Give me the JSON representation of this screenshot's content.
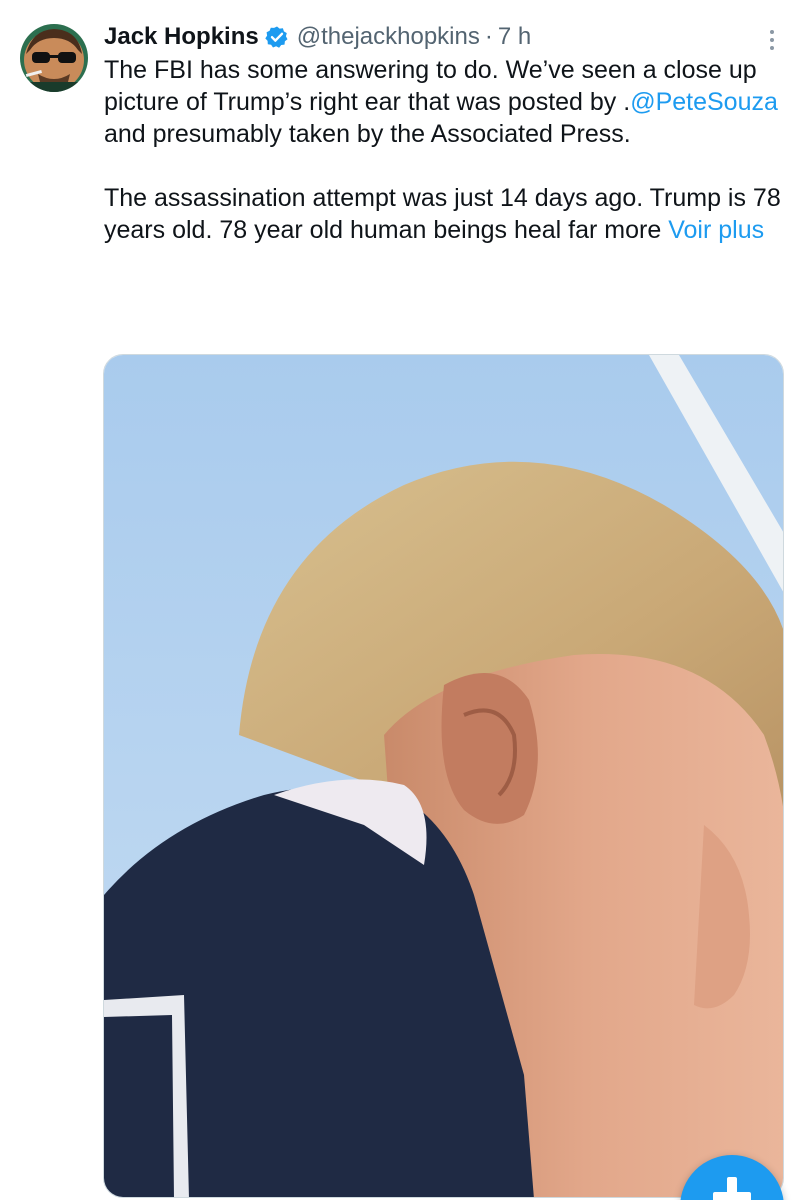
{
  "tweet": {
    "author": {
      "name": "Jack Hopkins",
      "handle": "@thejackhopkins",
      "separator": "·",
      "time": "7 h",
      "verified": true,
      "verified_icon": "verified-badge-icon",
      "avatar_icon": "avatar"
    },
    "text": {
      "p1_before": "The FBI has some answering to do. We’ve seen a close up picture of Trump’s right ear that was posted by .",
      "p1_mention": "@PeteSouza",
      "p1_after": " and presumably taken by the Associated Press.",
      "p2_before": "The assassination attempt was just 14 days ago. Trump is 78 years old. 78 year old human beings heal far more ",
      "p2_more": "Voir plus"
    },
    "more_icon": "more-vertical-icon",
    "media": {
      "type": "photo"
    },
    "compose_icon": "plus-icon"
  },
  "colors": {
    "accent": "#1d9bf0",
    "text": "#0f1419",
    "secondary": "#536471",
    "border": "#cfd9de"
  }
}
